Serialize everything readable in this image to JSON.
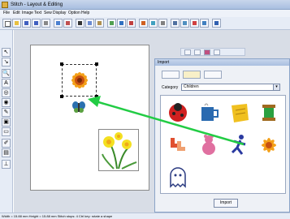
{
  "window": {
    "title": "Stitch - Layout & Editing"
  },
  "menu": [
    "File",
    "Edit",
    "Image",
    "Text",
    "Sew",
    "Display",
    "Option",
    "Help"
  ],
  "panel": {
    "title": "Import",
    "category_label": "Category",
    "category_value": "Children",
    "import_label": "Import"
  },
  "status": {
    "text": "Width = 15.88 mm  Height = 15.88 mm  Stitch stops: 4  Ctrl key: rotate a shape"
  },
  "colors": {
    "accent": "#22cc44",
    "arrow": "#22cc44"
  },
  "icons": {
    "tools_left": [
      "select-icon",
      "point-icon",
      "zoom-icon",
      "text-icon",
      "shape-icon",
      "fill-icon",
      "brush-icon",
      "stamp-icon",
      "eraser-icon",
      "pen-icon",
      "image-icon",
      "measure-icon"
    ],
    "grid": [
      "ladybug-icon",
      "mug-icon",
      "note-icon",
      "spool-icon",
      "socks-icon",
      "bear-icon",
      "runner-icon",
      "sunflower-icon",
      "ghost-icon"
    ]
  }
}
